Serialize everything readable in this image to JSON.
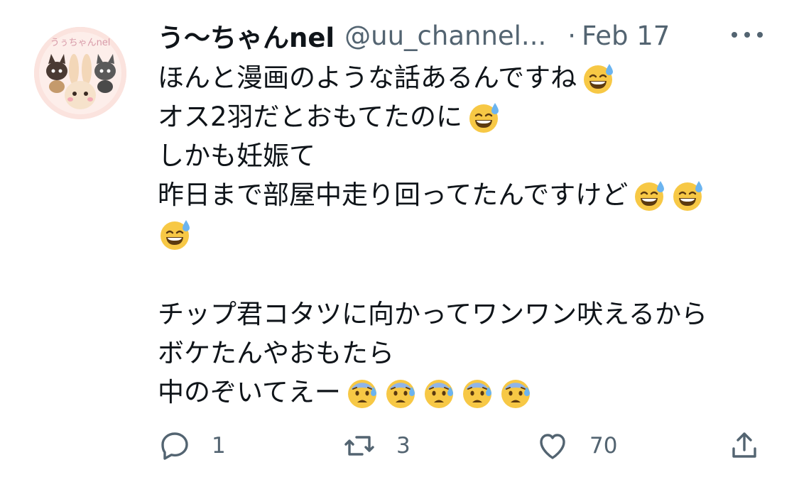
{
  "tweet": {
    "display_name": "う〜ちゃんnel",
    "handle": "@uu_channel...",
    "separator": "·",
    "date": "Feb 17",
    "avatar_text": "うぅちゃんnel",
    "lines": [
      {
        "text": "ほんと漫画のような話あるんですね",
        "emoji": [
          "grinning-face-with-sweat"
        ]
      },
      {
        "text": "オス2羽だとおもてたのに",
        "emoji": [
          "grinning-face-with-sweat"
        ]
      },
      {
        "text": "しかも妊娠て",
        "emoji": []
      },
      {
        "text": "昨日まで部屋中走り回ってたんですけど",
        "emoji": [
          "grinning-face-with-sweat",
          "grinning-face-with-sweat"
        ]
      },
      {
        "text": "",
        "emoji": [
          "grinning-face-with-sweat"
        ]
      },
      {
        "text": "",
        "emoji": []
      },
      {
        "text": "チップ君コタツに向かってワンワン吠えるから",
        "emoji": []
      },
      {
        "text": "ボケたんやおもたら",
        "emoji": []
      },
      {
        "text": "中のぞいてえー",
        "emoji": [
          "anxious-face-with-sweat",
          "anxious-face-with-sweat",
          "anxious-face-with-sweat",
          "anxious-face-with-sweat",
          "anxious-face-with-sweat"
        ]
      }
    ]
  },
  "actions": {
    "reply": {
      "icon": "reply-icon",
      "count": "1"
    },
    "retweet": {
      "icon": "retweet-icon",
      "count": "3"
    },
    "like": {
      "icon": "heart-icon",
      "count": "70"
    },
    "share": {
      "icon": "share-icon"
    }
  },
  "colors": {
    "text": "#0f1419",
    "secondary": "#536471",
    "emoji_face": "#f7c845",
    "sweat": "#6bb4f0"
  }
}
